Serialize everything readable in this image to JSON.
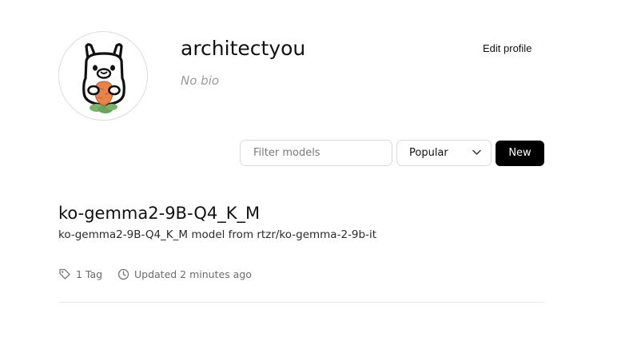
{
  "profile": {
    "username": "architectyou",
    "bio": "No bio",
    "edit_label": "Edit profile",
    "avatar_icon": "llama-avatar-icon"
  },
  "controls": {
    "filter_placeholder": "Filter models",
    "filter_value": "",
    "sort_selected": "Popular",
    "new_label": "New"
  },
  "models": [
    {
      "name": "ko-gemma2-9B-Q4_K_M",
      "description": "ko-gemma2-9B-Q4_K_M model from rtzr/ko-gemma-2-9b-it",
      "tags_label": "1 Tag",
      "updated_label": "Updated 2 minutes ago"
    }
  ],
  "colors": {
    "primary_button_bg": "#000000",
    "primary_button_text": "#ffffff",
    "border": "#d9d9d9",
    "muted_text": "#6b6b6b",
    "carrot": "#e8844a",
    "leaf": "#7ab36b"
  }
}
